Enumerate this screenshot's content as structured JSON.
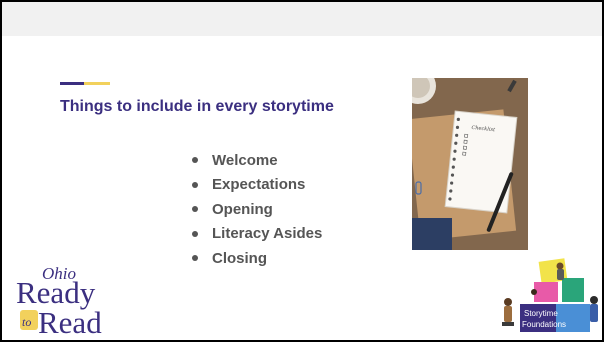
{
  "slide": {
    "title": "Things to include in every storytime",
    "bullets": [
      "Welcome",
      "Expectations",
      "Opening",
      "Literacy Asides",
      "Closing"
    ]
  },
  "photo": {
    "notebook_label": "Checklist"
  },
  "logos": {
    "ohio_ready_to_read": {
      "line1": "Ohio",
      "line2": "Ready",
      "line3_small": "to",
      "line3": "Read"
    },
    "storytime_foundations": {
      "line1": "Storytime",
      "line2": "Foundations"
    }
  },
  "colors": {
    "title": "#3b2f80",
    "accent_navy": "#3b2f80",
    "accent_gold": "#f2d15c",
    "bullet_text": "#555555",
    "top_band": "#f1f1f1"
  }
}
